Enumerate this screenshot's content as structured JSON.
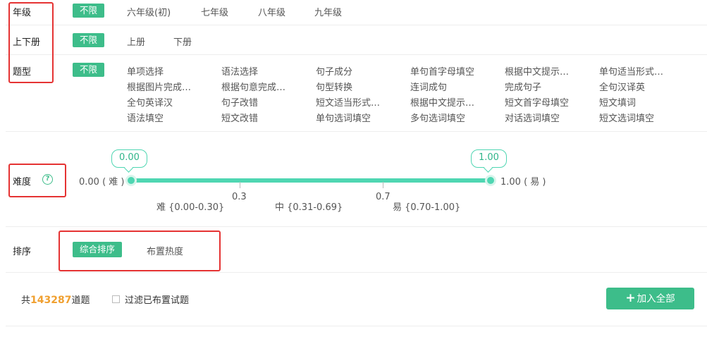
{
  "grade": {
    "label": "年级",
    "all": "不限",
    "options": [
      "六年级(初)",
      "七年级",
      "八年级",
      "九年级"
    ]
  },
  "volume": {
    "label": "上下册",
    "all": "不限",
    "options": [
      "上册",
      "下册"
    ]
  },
  "qtype": {
    "label": "题型",
    "all": "不限",
    "rows": [
      [
        "单项选择",
        "语法选择",
        "句子成分",
        "单句首字母填空",
        "根据中文提示…",
        "单句适当形式…"
      ],
      [
        "根据图片完成…",
        "根据句意完成…",
        "句型转换",
        "连词成句",
        "完成句子",
        "全句汉译英"
      ],
      [
        "全句英译汉",
        "句子改错",
        "短文适当形式…",
        "根据中文提示…",
        "短文首字母填空",
        "短文填词"
      ],
      [
        "语法填空",
        "短文改错",
        "单句选词填空",
        "多句选词填空",
        "对话选词填空",
        "短文选词填空"
      ]
    ]
  },
  "difficulty": {
    "label": "难度",
    "help_icon": "?",
    "min_text": "0.00 ( 难 )",
    "max_text": "1.00 ( 易 )",
    "low_value": "0.00",
    "high_value": "1.00",
    "tick1": "0.3",
    "tick2": "0.7",
    "band_hard": "难 {0.00-0.30}",
    "band_mid": "中 {0.31-0.69}",
    "band_easy": "易 {0.70-1.00}",
    "accent": "#4fd6b2"
  },
  "sort": {
    "label": "排序",
    "active": "综合排序",
    "other": "布置热度"
  },
  "footer": {
    "prefix": "共",
    "count": "143287",
    "suffix": "道题",
    "filter_label": "过滤已布置试题",
    "add_all": "加入全部",
    "add_icon": "+"
  },
  "colors": {
    "brand": "#3dbd8a",
    "highlight_box": "#e53333",
    "count": "#f0a030"
  }
}
